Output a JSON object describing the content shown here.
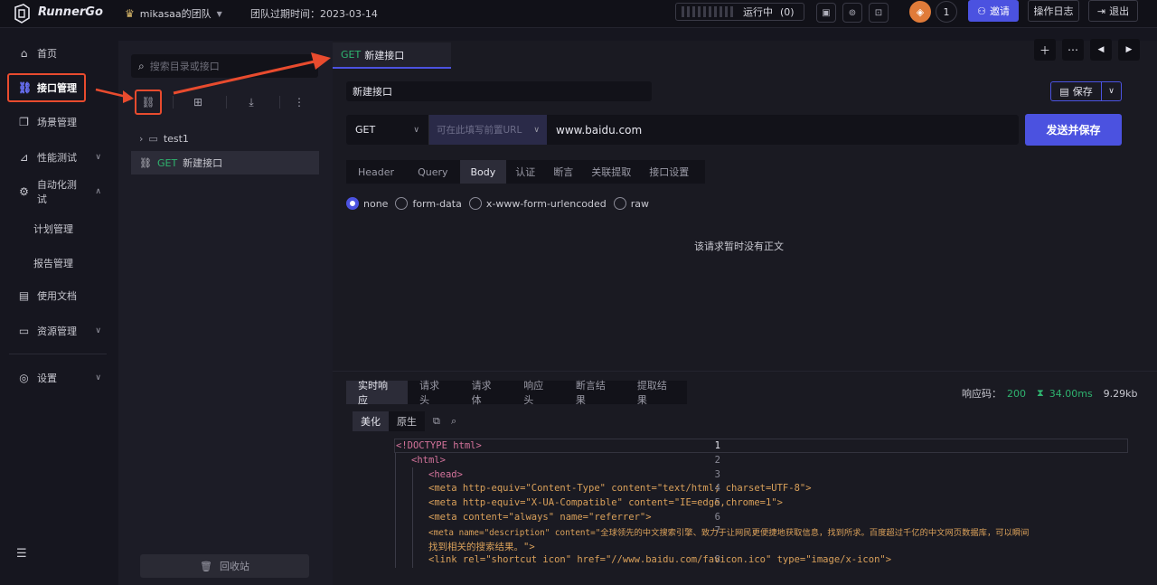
{
  "topbar": {
    "brand": "RunnerGo",
    "team_name": "mikasaa的团队",
    "expire_label": "团队过期时间：2023-03-14",
    "running_label": "运行中",
    "running_count": "(0)",
    "badge_count": "1",
    "invite_label": "邀请",
    "oplog_label": "操作日志",
    "logout_label": "退出"
  },
  "sidebar": {
    "items": [
      {
        "label": "首页",
        "icon": "home-icon"
      },
      {
        "label": "接口管理",
        "icon": "link-icon"
      },
      {
        "label": "场景管理",
        "icon": "scene-icon"
      },
      {
        "label": "性能测试",
        "icon": "chart-icon"
      },
      {
        "label": "自动化测试",
        "icon": "gears-icon"
      },
      {
        "label": "计划管理"
      },
      {
        "label": "报告管理"
      },
      {
        "label": "使用文档",
        "icon": "doc-icon"
      },
      {
        "label": "资源管理",
        "icon": "resource-icon"
      },
      {
        "label": "设置",
        "icon": "settings-icon"
      }
    ]
  },
  "tree": {
    "search_placeholder": "搜索目录或接口",
    "folder": "test1",
    "item_method": "GET",
    "item_name": "新建接口",
    "recycle_label": "回收站"
  },
  "tab": {
    "method": "GET",
    "name": "新建接口"
  },
  "editor": {
    "name_value": "新建接口",
    "save_label": "保存",
    "method": "GET",
    "pre_url_placeholder": "可在此填写前置URL",
    "url": "www.baidu.com",
    "send_label": "发送并保存",
    "subtabs": [
      "Header",
      "Query",
      "Body",
      "认证",
      "断言",
      "关联提取",
      "接口设置"
    ],
    "active_subtab": "Body",
    "body_types": [
      "none",
      "form-data",
      "x-www-form-urlencoded",
      "raw"
    ],
    "selected_body_type": "none",
    "empty_text": "该请求暂时没有正文"
  },
  "response": {
    "tabs": [
      "实时响应",
      "请求头",
      "请求体",
      "响应头",
      "断言结果",
      "提取结果"
    ],
    "active_tab": "实时响应",
    "status_label": "响应码：",
    "status_code": "200",
    "time": "34.00ms",
    "size": "9.29kb",
    "format_tabs": [
      "美化",
      "原生"
    ],
    "line_numbers": [
      "1",
      "2",
      "3",
      "4",
      "5",
      "6",
      "7",
      "8"
    ],
    "code_lines": [
      "<!DOCTYPE html>",
      "<html>",
      "<head>",
      "<meta http-equiv=\"Content-Type\" content=\"text/html; charset=UTF-8\">",
      "<meta http-equiv=\"X-UA-Compatible\" content=\"IE=edge,chrome=1\">",
      "<meta content=\"always\" name=\"referrer\">",
      "<meta name=\"description\" content=\"全球领先的中文搜索引擎、致力于让网民更便捷地获取信息，找到所求。百度超过千亿的中文网页数据库，可以瞬间",
      "找到相关的搜索结果。\">",
      "<link rel=\"shortcut icon\" href=\"//www.baidu.com/favicon.ico\" type=\"image/x-icon\">"
    ]
  },
  "colors": {
    "accent": "#4b52e0",
    "get_method": "#2fb36f",
    "highlight_annotation": "#e84b2e"
  }
}
